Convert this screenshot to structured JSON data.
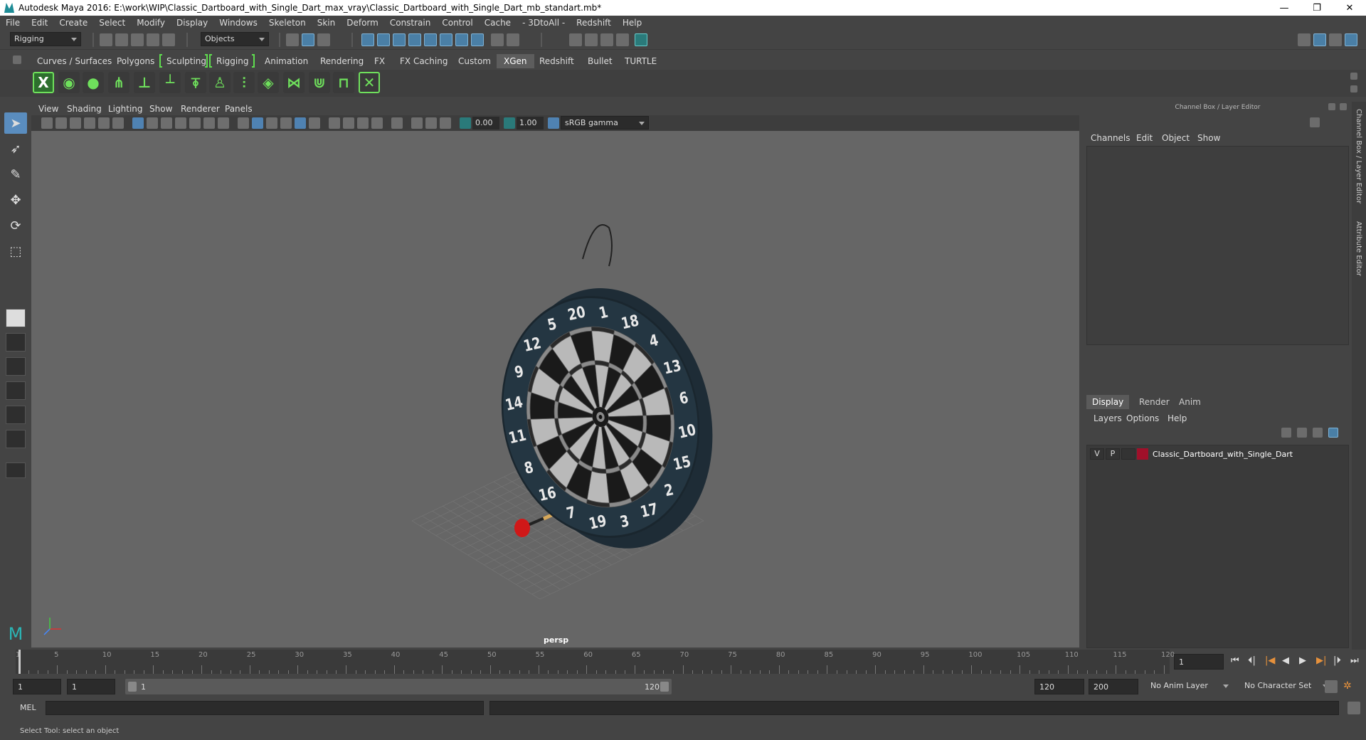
{
  "title": "Autodesk Maya 2016: E:\\work\\WIP\\Classic_Dartboard_with_Single_Dart_max_vray\\Classic_Dartboard_with_Single_Dart_mb_standart.mb*",
  "window_controls": {
    "minimize": "—",
    "restore": "❐",
    "close": "✕"
  },
  "menu": [
    "File",
    "Edit",
    "Create",
    "Select",
    "Modify",
    "Display",
    "Windows",
    "Skeleton",
    "Skin",
    "Deform",
    "Constrain",
    "Control",
    "Cache",
    "- 3DtoAll -",
    "Redshift",
    "Help"
  ],
  "status": {
    "mode": "Rigging",
    "selection_mode": "Objects"
  },
  "shelf_tabs": [
    "Curves / Surfaces",
    "Polygons",
    "Sculpting",
    "Rigging",
    "Animation",
    "Rendering",
    "FX",
    "FX Caching",
    "Custom",
    "XGen",
    "Redshift",
    "Bullet",
    "TURTLE"
  ],
  "active_shelf_tab": "XGen",
  "viewport": {
    "menus": [
      "View",
      "Shading",
      "Lighting",
      "Show",
      "Renderer",
      "Panels"
    ],
    "exposure": "0.00",
    "gamma": "1.00",
    "colorspace": "sRGB gamma",
    "camera": "persp"
  },
  "dartboard_numbers": [
    "20",
    "1",
    "18",
    "4",
    "13",
    "6",
    "10",
    "15",
    "2",
    "17",
    "3",
    "19",
    "7",
    "16",
    "8",
    "11",
    "14",
    "9",
    "12",
    "5"
  ],
  "channel_box": {
    "title": "Channel Box / Layer Editor",
    "menu": [
      "Channels",
      "Edit",
      "Object",
      "Show"
    ]
  },
  "layer_editor": {
    "tabs": [
      "Display",
      "Render",
      "Anim"
    ],
    "active_tab": "Display",
    "menu": [
      "Layers",
      "Options",
      "Help"
    ],
    "layers": [
      {
        "v": "V",
        "p": "P",
        "color": "#a0102a",
        "name": "Classic_Dartboard_with_Single_Dart"
      }
    ]
  },
  "side_tabs": [
    "Channel Box / Layer Editor",
    "Attribute Editor"
  ],
  "timeline": {
    "ticks": [
      1,
      5,
      10,
      15,
      20,
      25,
      30,
      35,
      40,
      45,
      50,
      55,
      60,
      65,
      70,
      75,
      80,
      85,
      90,
      95,
      100,
      105,
      110,
      115,
      120
    ],
    "current_frame": "1",
    "playback_buttons": [
      "⏮",
      "⏴|",
      "|◀",
      "◀",
      "▶",
      "▶|",
      "|⏵",
      "⏭"
    ]
  },
  "range": {
    "start": "1",
    "playback_start": "1",
    "slider_start": "1",
    "slider_end": "120",
    "playback_end": "120",
    "end": "200",
    "anim_layer": "No Anim Layer",
    "character_set": "No Character Set"
  },
  "command_line": {
    "label": "MEL"
  },
  "help_line": "Select Tool: select an object"
}
